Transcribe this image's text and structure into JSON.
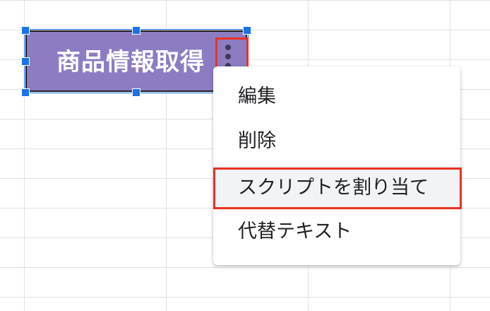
{
  "drawing": {
    "label": "商品情報取得",
    "fill_color": "#8e7cc3",
    "text_color": "#ffffff"
  },
  "kebab_menu": {
    "icon": "more-vertical-icon"
  },
  "context_menu": {
    "items": [
      {
        "label": "編集"
      },
      {
        "label": "削除"
      },
      {
        "label": "スクリプトを割り当て",
        "highlighted": true
      },
      {
        "label": "代替テキスト"
      }
    ]
  },
  "colors": {
    "selection_handle": "#1a73e8",
    "annotation_red": "#ea3323",
    "grid_line": "#e1e1e1",
    "highlight_bg": "#f1f3f4"
  }
}
